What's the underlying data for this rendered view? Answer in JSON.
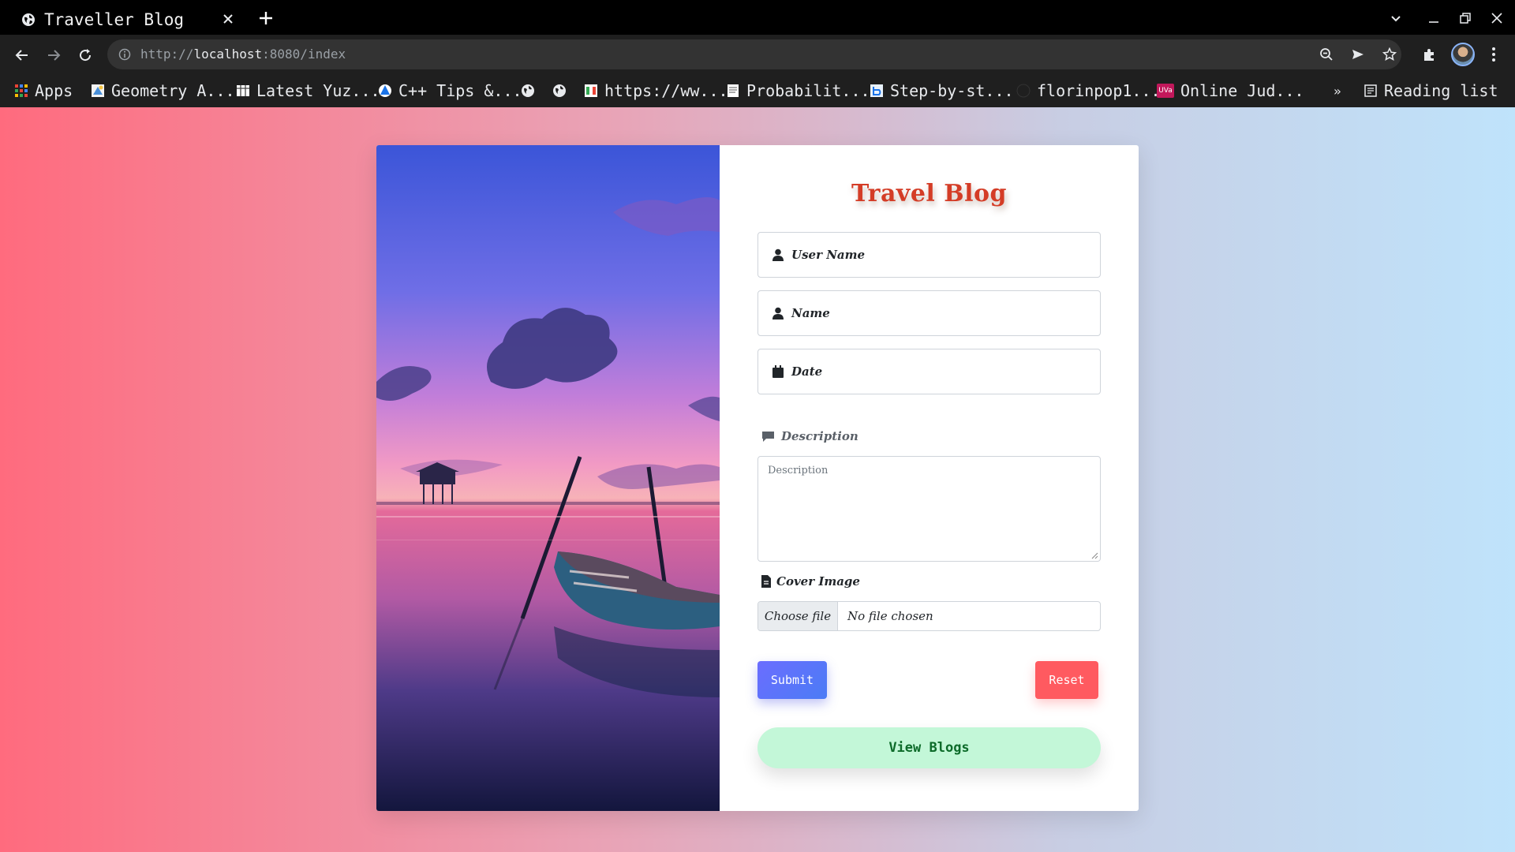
{
  "browser": {
    "tab_title": "Traveller Blog",
    "url_scheme": "http://",
    "url_host": "localhost",
    "url_rest": ":8080/index",
    "bookmarks": [
      {
        "label": "Apps",
        "icon": "apps-grid-icon"
      },
      {
        "label": "Geometry A...",
        "icon": "bookmark-favicon-icon"
      },
      {
        "label": "Latest Yuz...",
        "icon": "bookmark-favicon-icon"
      },
      {
        "label": "C++ Tips &...",
        "icon": "bookmark-favicon-icon"
      },
      {
        "label": "",
        "icon": "globe-icon"
      },
      {
        "label": "",
        "icon": "globe-icon"
      },
      {
        "label": "https://ww...",
        "icon": "bookmark-favicon-icon"
      },
      {
        "label": "Probabilit...",
        "icon": "bookmark-favicon-icon"
      },
      {
        "label": "Step-by-st...",
        "icon": "bookmark-favicon-icon"
      },
      {
        "label": "florinpop1...",
        "icon": "github-icon"
      },
      {
        "label": "Online Jud...",
        "icon": "uva-icon"
      }
    ],
    "overflow_label": "»",
    "reading_list": "Reading list",
    "uva_badge": "UVa"
  },
  "form": {
    "title": "Travel Blog",
    "username_placeholder": "User Name",
    "name_placeholder": "Name",
    "date_placeholder": "Date",
    "description_label": "Description",
    "description_placeholder": "Description",
    "cover_label": "Cover Image",
    "choose_file": "Choose file",
    "file_status": "No file chosen",
    "submit": "Submit",
    "reset": "Reset",
    "view_blogs": "View Blogs"
  },
  "colors": {
    "title": "#d43c26",
    "submit": "#5a75f8",
    "reset": "#ff5a60",
    "view_blogs_bg": "#c3f7d8",
    "view_blogs_text": "#0d6b2a",
    "description_label": "#5a6068"
  }
}
